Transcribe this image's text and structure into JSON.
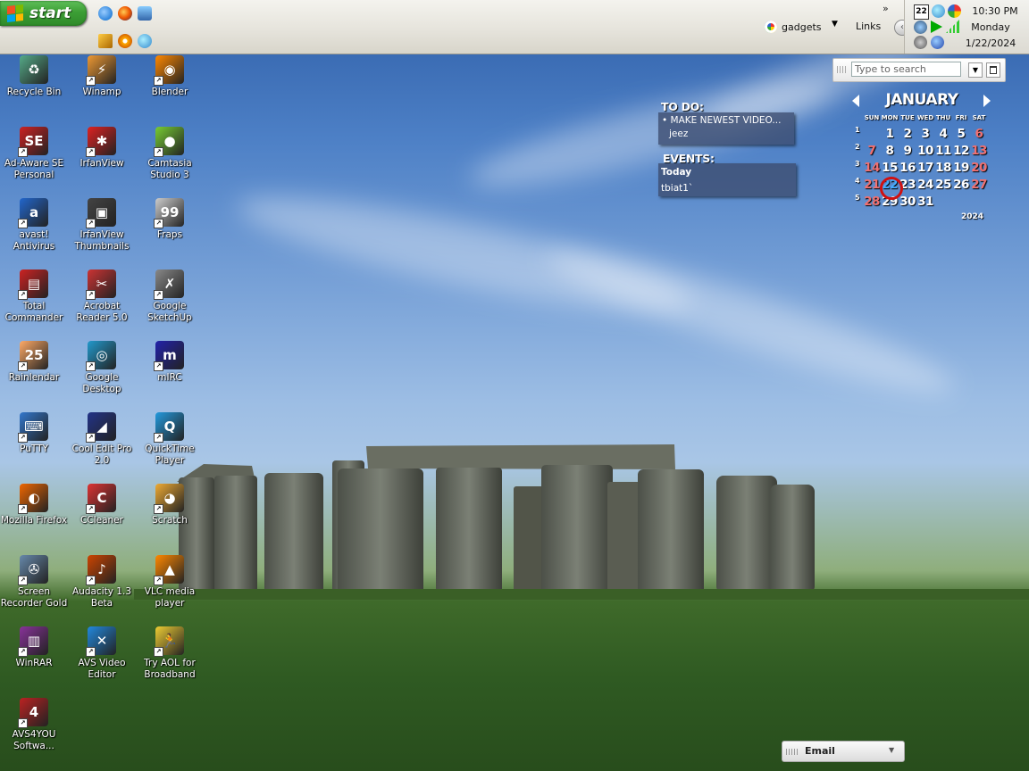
{
  "taskbar": {
    "start_label": "start",
    "gadgets_label": "gadgets",
    "links_label": "Links",
    "more_chevron": "»"
  },
  "clock": {
    "time": "10:30 PM",
    "day": "Monday",
    "date": "1/22/2024",
    "tray_badge": "22"
  },
  "desktop_icons": [
    {
      "label": "Recycle Bin",
      "icon": "recycle-bin-icon"
    },
    {
      "label": "Winamp",
      "icon": "winamp-icon"
    },
    {
      "label": "Blender",
      "icon": "blender-icon"
    },
    {
      "label": "Ad-Aware SE Personal",
      "icon": "ad-aware-icon"
    },
    {
      "label": "IrfanView",
      "icon": "irfanview-icon"
    },
    {
      "label": "Camtasia Studio 3",
      "icon": "camtasia-icon"
    },
    {
      "label": "avast! Antivirus",
      "icon": "avast-icon"
    },
    {
      "label": "IrfanView Thumbnails",
      "icon": "irfanview-thumbnails-icon"
    },
    {
      "label": "Fraps",
      "icon": "fraps-icon"
    },
    {
      "label": "Total Commander",
      "icon": "total-commander-icon"
    },
    {
      "label": "Acrobat Reader 5.0",
      "icon": "acrobat-reader-icon"
    },
    {
      "label": "Google SketchUp",
      "icon": "sketchup-icon"
    },
    {
      "label": "Rainlendar",
      "icon": "rainlendar-icon"
    },
    {
      "label": "Google Desktop",
      "icon": "google-desktop-icon"
    },
    {
      "label": "mIRC",
      "icon": "mirc-icon"
    },
    {
      "label": "PuTTY",
      "icon": "putty-icon"
    },
    {
      "label": "Cool Edit Pro 2.0",
      "icon": "cool-edit-icon"
    },
    {
      "label": "QuickTime Player",
      "icon": "quicktime-icon"
    },
    {
      "label": "Mozilla Firefox",
      "icon": "firefox-icon"
    },
    {
      "label": "CCleaner",
      "icon": "ccleaner-icon"
    },
    {
      "label": "Scratch",
      "icon": "scratch-icon"
    },
    {
      "label": "Screen Recorder Gold",
      "icon": "screen-recorder-icon"
    },
    {
      "label": "Audacity 1.3 Beta",
      "icon": "audacity-icon"
    },
    {
      "label": "VLC media player",
      "icon": "vlc-icon"
    },
    {
      "label": "WinRAR",
      "icon": "winrar-icon"
    },
    {
      "label": "AVS Video Editor",
      "icon": "avs-video-editor-icon"
    },
    {
      "label": "Try AOL for Broadband",
      "icon": "aol-icon"
    },
    {
      "label": "AVS4YOU Softwa...",
      "icon": "avs4you-icon"
    }
  ],
  "search": {
    "placeholder": "Type to search"
  },
  "todo": {
    "title": "TO DO:",
    "items": [
      "• MAKE NEWEST VIDEO...",
      "jeez"
    ]
  },
  "events": {
    "title": "EVENTS:",
    "heading": "Today",
    "items": [
      "tbiat1`"
    ]
  },
  "calendar": {
    "month": "JANUARY",
    "year": "2024",
    "weekdays": [
      "SUN",
      "MON",
      "TUE",
      "WED",
      "THU",
      "FRI",
      "SAT"
    ],
    "week_numbers": [
      "1",
      "2",
      "3",
      "4",
      "5"
    ],
    "days": [
      "1",
      "2",
      "3",
      "4",
      "5",
      "6",
      "7",
      "8",
      "9",
      "10",
      "11",
      "12",
      "13",
      "14",
      "15",
      "16",
      "17",
      "18",
      "19",
      "20",
      "21",
      "22",
      "23",
      "24",
      "25",
      "26",
      "27",
      "28",
      "29",
      "30",
      "31"
    ],
    "today": "22"
  },
  "email": {
    "label": "Email"
  },
  "colors": {
    "start_green": "#3c9e35",
    "weekend_red": "#f07070",
    "today_ring": "#d01010"
  }
}
